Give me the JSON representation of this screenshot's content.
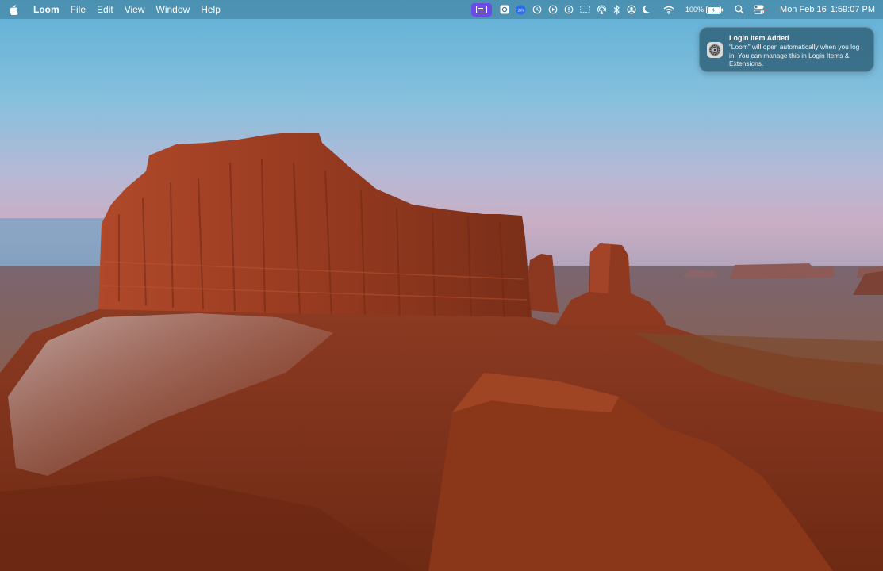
{
  "menubar": {
    "app_name": "Loom",
    "menus": [
      "File",
      "Edit",
      "View",
      "Window",
      "Help"
    ],
    "tray_icons": [
      "loom-recorder-icon",
      "screen-record-icon",
      "zoom-icon",
      "time-machine-icon",
      "play-icon",
      "info-icon",
      "screen-mirror-icon",
      "airdrop-icon",
      "bluetooth-icon",
      "user-icon",
      "moon-icon",
      "wifi-icon",
      "battery-icon",
      "search-icon",
      "control-center-icon"
    ],
    "battery_percent": "100%",
    "date": "Mon Feb 16",
    "time": "1:59:07 PM"
  },
  "notification": {
    "title": "Login Item Added",
    "body": "“Loom” will open automatically when you log in. You can manage this in Login Items & Extensions.",
    "icon": "system-settings-gear-icon"
  },
  "colors": {
    "menubar": "#3c7896",
    "loom_accent": "#6a4be6",
    "notification_bg": "#2d5f78"
  }
}
